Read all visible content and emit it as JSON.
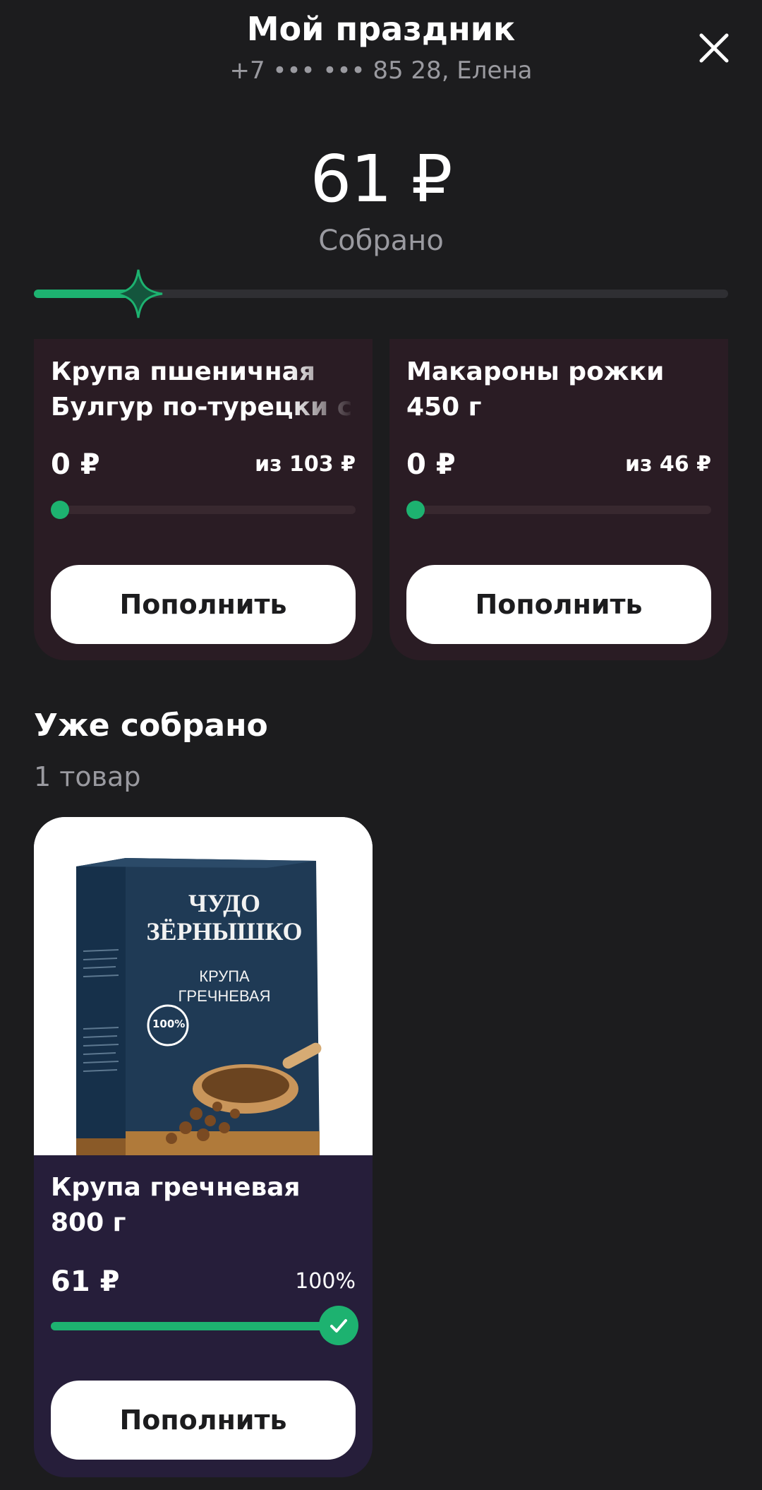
{
  "header": {
    "title": "Мой праздник",
    "subtitle": "+7 ••• ••• 85 28, Елена"
  },
  "summary": {
    "total": "61 ₽",
    "label": "Собрано",
    "progress_fraction": 0.15
  },
  "pending_items": [
    {
      "name": "Крупа пшеничная Булгур по-турецки с",
      "amount": "0 ₽",
      "goal": "из 103 ₽",
      "progress_fraction": 0,
      "button": "Пополнить"
    },
    {
      "name": "Макароны рожки 450 г",
      "amount": "0 ₽",
      "goal": "из 46 ₽",
      "progress_fraction": 0,
      "button": "Пополнить"
    }
  ],
  "collected": {
    "title": "Уже собрано",
    "count": "1 товар",
    "items": [
      {
        "name": "Крупа гречневая 800 г",
        "amount": "61 ₽",
        "percent": "100%",
        "progress_fraction": 1,
        "button": "Пополнить",
        "image": {
          "brand_line1": "ЧУДО",
          "brand_line2": "ЗЁРНЫШКО",
          "product_line1": "КРУПА",
          "product_line2": "ГРЕЧНЕВАЯ",
          "badge": "100%"
        }
      }
    ]
  },
  "colors": {
    "accent": "#1db270",
    "background": "#1c1c1e",
    "pending_card": "#2a1c24",
    "done_card": "#261e3a",
    "package": "#1f3a55"
  }
}
